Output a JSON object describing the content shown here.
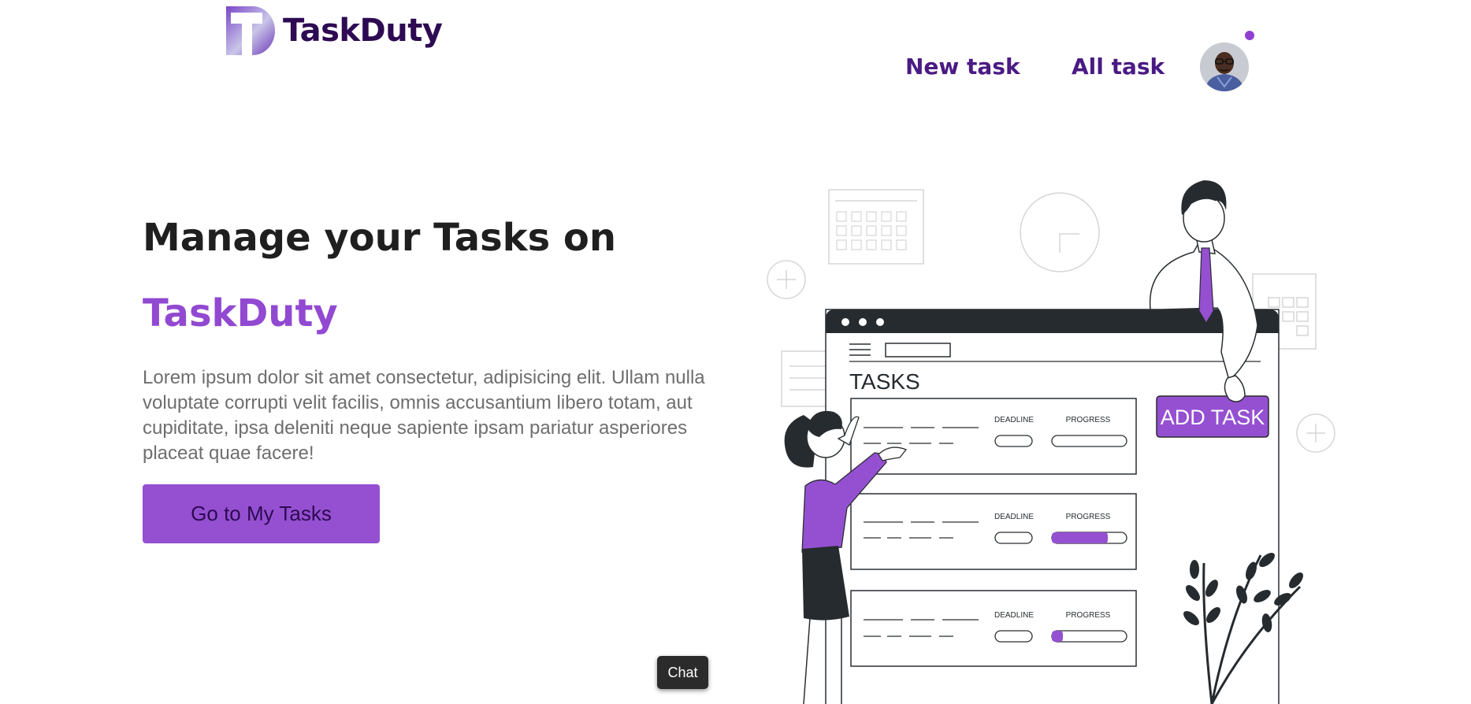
{
  "header": {
    "logo_text": "TaskDuty",
    "nav": {
      "new_task": "New task",
      "all_task": "All task"
    }
  },
  "hero": {
    "title": "Manage your Tasks on",
    "brand": "TaskDuty",
    "description": "Lorem ipsum dolor sit amet consectetur, adipisicing elit. Ullam nulla voluptate corrupti velit facilis, omnis accusantium libero totam, aut cupiditate, ipsa deleniti neque sapiente ipsam pariatur asperiores placeat quae facere!",
    "cta_label": "Go to My Tasks"
  },
  "illustration": {
    "tasks_heading": "TASKS",
    "add_task_label": "ADD TASK",
    "deadline_label": "DEADLINE",
    "progress_label": "PROGRESS",
    "task_progress": [
      0,
      0.75,
      0.15
    ]
  },
  "chat": {
    "label": "Chat"
  },
  "colors": {
    "brand_purple": "#9249d1",
    "nav_purple": "#4a1a84",
    "dark": "#2d0a52"
  }
}
